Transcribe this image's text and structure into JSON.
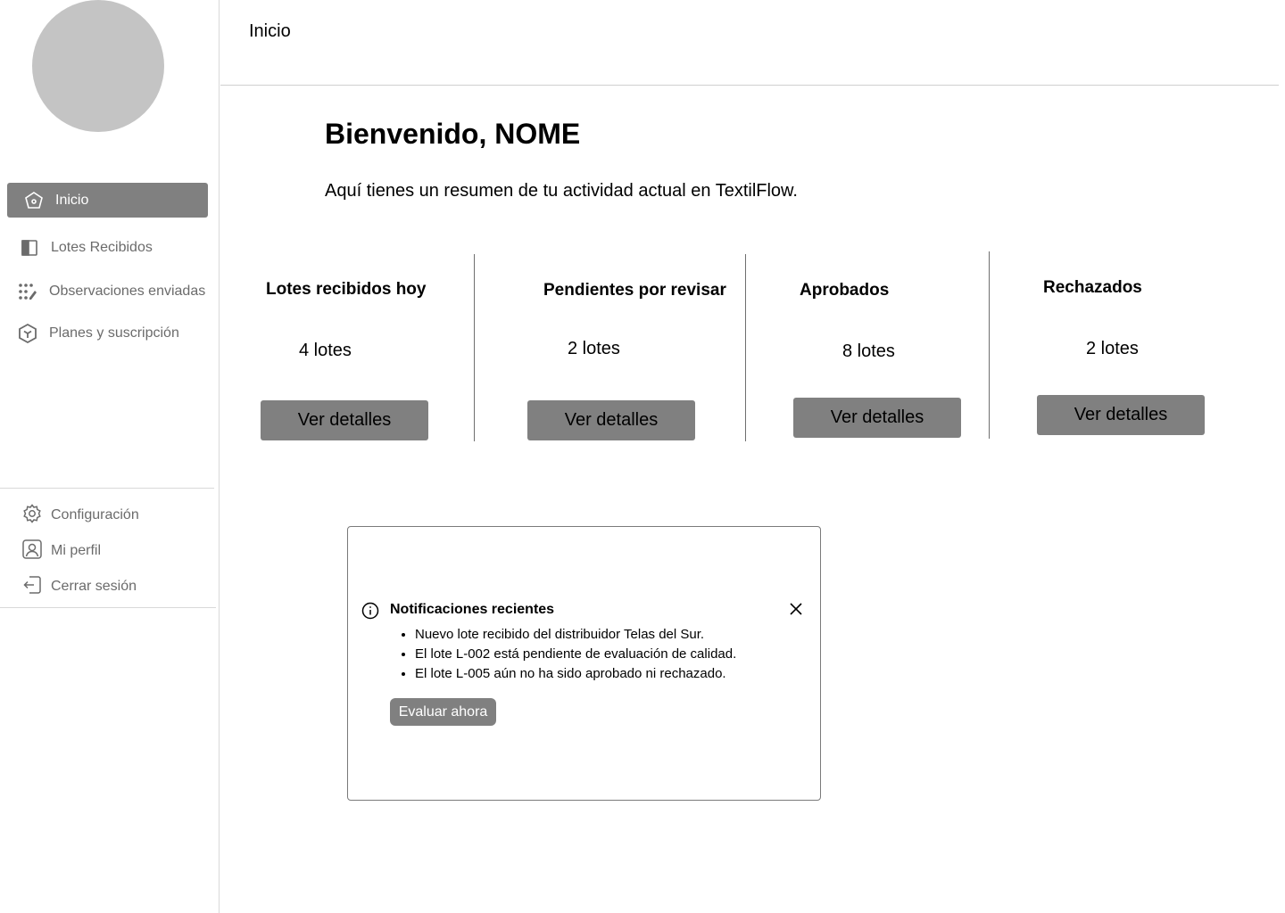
{
  "header": {
    "title": "Inicio"
  },
  "sidebar": {
    "items": [
      {
        "label": "Inicio",
        "icon": "home-icon",
        "active": true
      },
      {
        "label": "Lotes Recibidos",
        "icon": "panel-icon"
      },
      {
        "label": "Observaciones enviadas",
        "icon": "dots-edit-icon"
      },
      {
        "label": "Planes y suscripción",
        "icon": "cube-icon"
      }
    ],
    "bottom_items": [
      {
        "label": "Configuración",
        "icon": "gear-icon"
      },
      {
        "label": "Mi perfil",
        "icon": "user-icon"
      },
      {
        "label": "Cerrar sesión",
        "icon": "logout-icon"
      }
    ]
  },
  "main": {
    "welcome_title": "Bienvenido, NOME",
    "welcome_subtitle": "Aquí tienes un resumen de tu actividad actual en TextilFlow.",
    "stats": [
      {
        "title": "Lotes recibidos hoy",
        "value": "4 lotes",
        "button": "Ver detalles"
      },
      {
        "title": "Pendientes por revisar",
        "value": "2 lotes",
        "button": "Ver detalles"
      },
      {
        "title": "Aprobados",
        "value": "8 lotes",
        "button": "Ver detalles"
      },
      {
        "title": "Rechazados",
        "value": "2 lotes",
        "button": "Ver detalles"
      }
    ]
  },
  "notification": {
    "title": "Notificaciones recientes",
    "items": [
      "Nuevo lote recibido del distribuidor Telas del Sur.",
      "El lote L-002 está pendiente de evaluación de calidad.",
      "El lote L-005 aún no ha sido aprobado ni rechazado."
    ],
    "action": "Evaluar ahora"
  },
  "colors": {
    "accent_gray": "#808080",
    "avatar_gray": "#c4c4c4",
    "muted_text": "#6b6b6b"
  }
}
